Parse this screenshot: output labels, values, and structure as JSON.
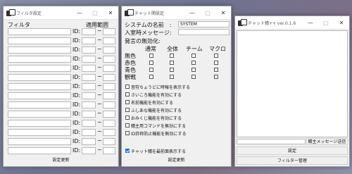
{
  "filter_window": {
    "title": "フィルタ設定",
    "header_filter": "フィルタ",
    "header_range": "適用範囲",
    "id_label": "ID:",
    "tilde": "~",
    "rows": 14,
    "update_button": "設定更新"
  },
  "chat_settings_window": {
    "title": "チャット関設定",
    "system_name_label": "システムの名前　:",
    "system_name_value": "SYSTEM",
    "join_message_label": "入室時メッセージ:",
    "disable_label": "発言の無効化:",
    "columns": [
      "通常",
      "全体",
      "チーム",
      "マクロ"
    ],
    "rows": [
      "無色",
      "赤色",
      "青色",
      "観戦"
    ],
    "options": [
      "音符ちょうどに時報を表示する",
      "さいころ機能を有効にする",
      "名前機能を有効にする",
      "ふしあな機能を有効にする",
      "おみくじ機能を有効にする",
      "鯖主用コマンドを無効にする",
      "ID詐称防止機能を無効にする"
    ],
    "topmost_label": "チャット鯖を最前面表示する",
    "update_button": "設定更新"
  },
  "main_window": {
    "title": "チャット鯖++ ver.0.1.6",
    "send_button": "鯖主メッセージ送信",
    "settings_button": "設定",
    "filter_button": "フィルター管理"
  },
  "titlebar_buttons": {
    "minimize": "—",
    "maximize": "□",
    "close": "✕"
  }
}
